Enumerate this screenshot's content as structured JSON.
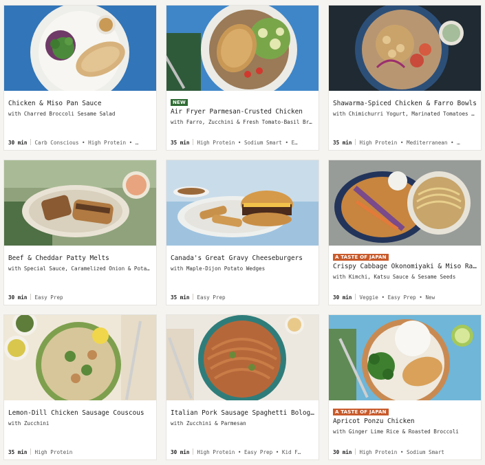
{
  "recipes": [
    {
      "title": "Chicken & Miso Pan Sauce",
      "subtitle": "with Charred Broccoli Sesame Salad",
      "time": "30 min",
      "tags": "Carb Conscious • High Protein • …",
      "badge": "",
      "image": "chicken-miso-photo"
    },
    {
      "title": "Air Fryer Parmesan-Crusted Chicken",
      "subtitle": "with Farro, Zucchini & Fresh Tomato-Basil Bruschet…",
      "time": "35 min",
      "tags": "High Protein • Sodium Smart • E…",
      "badge": "NEW",
      "image": "parmesan-chicken-photo"
    },
    {
      "title": "Shawarma-Spiced Chicken & Farro Bowls",
      "subtitle": "with Chimichurri Yogurt, Marinated Tomatoes & Pick…",
      "time": "35 min",
      "tags": "High Protein • Mediterranean • …",
      "badge": "",
      "image": "shawarma-bowl-photo"
    },
    {
      "title": "Beef & Cheddar Patty Melts",
      "subtitle": "with Special Sauce, Caramelized Onion & Potato We…",
      "time": "30 min",
      "tags": "Easy Prep",
      "badge": "",
      "image": "patty-melt-photo"
    },
    {
      "title": "Canada's Great Gravy Cheeseburgers",
      "subtitle": "with Maple-Dijon Potato Wedges",
      "time": "35 min",
      "tags": "Easy Prep",
      "badge": "",
      "image": "cheeseburger-photo"
    },
    {
      "title": "Crispy Cabbage Okonomiyaki & Miso Ra…",
      "subtitle": "with Kimchi, Katsu Sauce & Sesame Seeds",
      "time": "30 min",
      "tags": "Veggie • Easy Prep • New",
      "badge": "A TASTE OF JAPAN",
      "image": "okonomiyaki-photo"
    },
    {
      "title": "Lemon-Dill Chicken Sausage Couscous",
      "subtitle": "with Zucchini",
      "time": "35 min",
      "tags": "High Protein",
      "badge": "",
      "image": "couscous-photo"
    },
    {
      "title": "Italian Pork Sausage Spaghetti Bolognese",
      "subtitle": "with Zucchini & Parmesan",
      "time": "30 min",
      "tags": "High Protein • Easy Prep • Kid F…",
      "badge": "",
      "image": "bolognese-photo"
    },
    {
      "title": "Apricot Ponzu Chicken",
      "subtitle": "with Ginger Lime Rice & Roasted Broccoli",
      "time": "30 min",
      "tags": "High Protein • Sodium Smart",
      "badge": "A TASTE OF JAPAN",
      "image": "ponzu-chicken-photo"
    }
  ],
  "colors": {
    "new_badge": "#2f6b34",
    "japan_badge": "#c85a2b",
    "card_bg": "#ffffff",
    "page_bg": "#f5f4f1"
  }
}
